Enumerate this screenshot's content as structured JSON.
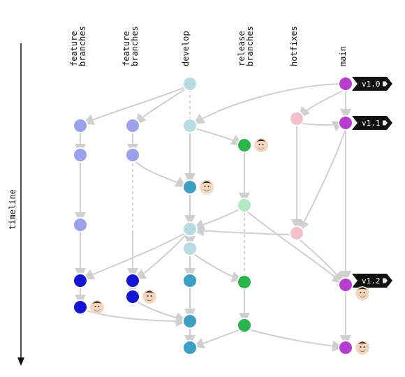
{
  "timeline_label": "timeline",
  "columns": {
    "feature_a": "feature\nbranches",
    "feature_b": "feature\nbranches",
    "develop": "develop",
    "release": "release\nbranches",
    "hotfix": "hotfixes",
    "main": "main"
  },
  "tags": {
    "t1": "v1.0",
    "t2": "v1.1",
    "t3": "v1.2"
  },
  "colors": {
    "feature_a": "#1414d2",
    "feature_b": "#1414d2",
    "feature_faded": "#9aa1ea",
    "develop": "#3b9ec4",
    "develop_faded": "#b9dbe6",
    "release": "#2ab54a",
    "release_faded": "#b6e9c3",
    "hotfix_faded": "#f3bfc8",
    "main": "#b63dd0"
  },
  "icons": {
    "avatar": "avatar",
    "tag": "tag-icon"
  }
}
